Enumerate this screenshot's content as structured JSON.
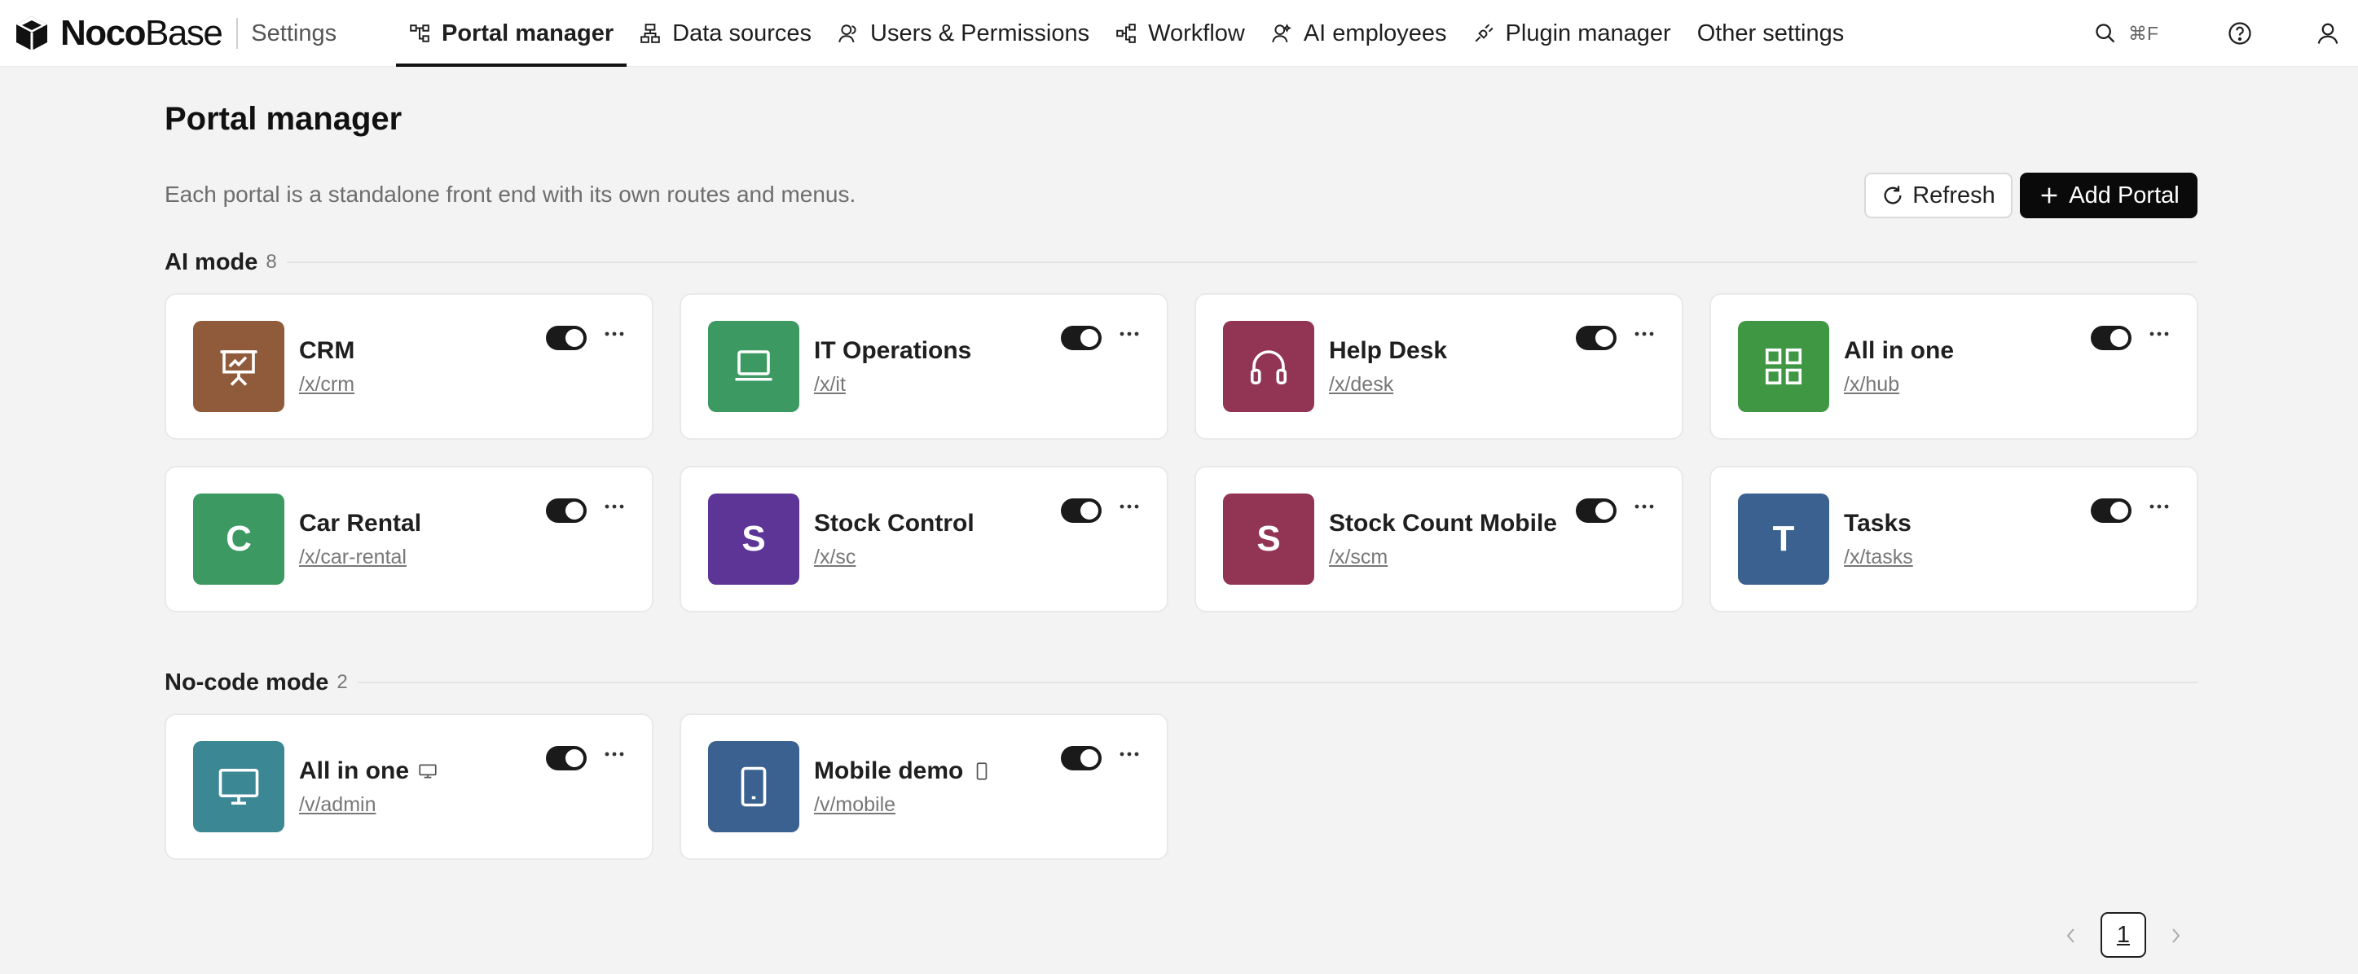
{
  "brand": {
    "name_bold": "Noco",
    "name_light": "Base",
    "section": "Settings"
  },
  "nav": {
    "items": [
      {
        "label": "Portal manager",
        "icon": "portal-icon",
        "active": true
      },
      {
        "label": "Data sources",
        "icon": "data-sources-icon"
      },
      {
        "label": "Users & Permissions",
        "icon": "users-icon"
      },
      {
        "label": "Workflow",
        "icon": "workflow-icon"
      },
      {
        "label": "AI employees",
        "icon": "ai-employee-icon"
      },
      {
        "label": "Plugin manager",
        "icon": "plugin-icon"
      },
      {
        "label": "Other settings"
      }
    ]
  },
  "topright": {
    "search_icon": "search-icon",
    "shortcut": "⌘F",
    "help_icon": "help-icon",
    "user_icon": "user-icon"
  },
  "page": {
    "title": "Portal manager",
    "description": "Each portal is a standalone front end with its own routes and menus.",
    "refresh_label": "Refresh",
    "add_label": "Add Portal"
  },
  "sections": [
    {
      "title": "AI mode",
      "count": "8",
      "cards": [
        {
          "title": "CRM",
          "path": "/x/crm",
          "color": "#8f5b3b",
          "icon": "presentation-chart-icon",
          "enabled": true
        },
        {
          "title": "IT Operations",
          "path": "/x/it",
          "color": "#3c9961",
          "icon": "laptop-icon",
          "enabled": true
        },
        {
          "title": "Help Desk",
          "path": "/x/desk",
          "color": "#923453",
          "icon": "headphones-icon",
          "enabled": true
        },
        {
          "title": "All in one",
          "path": "/x/hub",
          "color": "#3f9743",
          "icon": "grid-icon",
          "enabled": true
        },
        {
          "title": "Car Rental",
          "path": "/x/car-rental",
          "color": "#3b9961",
          "letter": "C",
          "enabled": true
        },
        {
          "title": "Stock Control",
          "path": "/x/sc",
          "color": "#5c3597",
          "letter": "S",
          "enabled": true
        },
        {
          "title": "Stock Count Mobile",
          "path": "/x/scm",
          "color": "#923453",
          "letter": "S",
          "enabled": true
        },
        {
          "title": "Tasks",
          "path": "/x/tasks",
          "color": "#3a6190",
          "letter": "T",
          "enabled": true
        }
      ]
    },
    {
      "title": "No-code mode",
      "count": "2",
      "cards": [
        {
          "title": "All in one",
          "path": "/v/admin",
          "color": "#3c8794",
          "icon": "monitor-icon",
          "badge": "desktop-icon",
          "enabled": true
        },
        {
          "title": "Mobile demo",
          "path": "/v/mobile",
          "color": "#3a6190",
          "icon": "mobile-icon",
          "badge": "mobile-small-icon",
          "enabled": true
        }
      ]
    }
  ],
  "pagination": {
    "current": "1"
  }
}
